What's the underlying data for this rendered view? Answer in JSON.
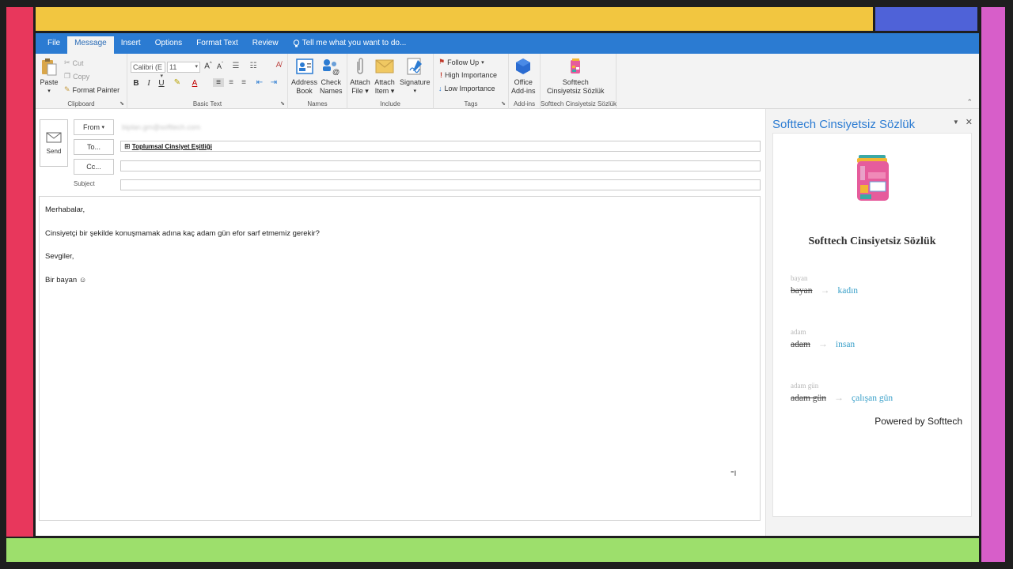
{
  "frame": {
    "left_color": "#e8375c",
    "top_color": "#f2c640",
    "top_right_color": "#4f62d8",
    "right_color": "#d75ec9",
    "bottom_color": "#9ddf6c",
    "accent": "#2b7bd2"
  },
  "menubar": {
    "tabs": [
      "File",
      "Message",
      "Insert",
      "Options",
      "Format Text",
      "Review"
    ],
    "active": "Message",
    "tell_me": "Tell me what you want to do..."
  },
  "ribbon": {
    "clipboard": {
      "paste": "Paste",
      "cut": "Cut",
      "copy": "Copy",
      "format_painter": "Format Painter",
      "label": "Clipboard"
    },
    "basic_text": {
      "font": "Calibri (E",
      "size": "11",
      "label": "Basic Text"
    },
    "names": {
      "address_book_1": "Address",
      "address_book_2": "Book",
      "check_names_1": "Check",
      "check_names_2": "Names",
      "label": "Names"
    },
    "include": {
      "attach_file_1": "Attach",
      "attach_file_2": "File",
      "attach_item_1": "Attach",
      "attach_item_2": "Item",
      "signature": "Signature",
      "label": "Include"
    },
    "tags": {
      "follow_up": "Follow Up",
      "high_importance": "High Importance",
      "low_importance": "Low Importance",
      "label": "Tags"
    },
    "addins": {
      "office_1": "Office",
      "office_2": "Add-ins",
      "label": "Add-ins"
    },
    "softtech": {
      "line1": "Softtech",
      "line2": "Cinsiyetsiz Sözlük",
      "label": "Softtech Cinsiyetsiz Sözlük"
    }
  },
  "compose": {
    "send": "Send",
    "from_label": "From",
    "from_value": "biplan.gm@softtech.com",
    "to_label": "To...",
    "to_value": "Toplumsal Cinsiyet Eşitliği",
    "cc_label": "Cc...",
    "subject_label": "Subject",
    "body": [
      "Merhabalar,",
      "Cinsiyetçi bir şekilde konuşmamak adına kaç adam gün efor sarf etmemiz gerekir?",
      "Sevgiler,",
      "Bir bayan ☺"
    ]
  },
  "pane": {
    "title": "Softtech Cinsiyetsiz Sözlük",
    "card_title": "Softtech Cinsiyetsiz Sözlük",
    "entries": [
      {
        "key": "bayan",
        "old": "bayan",
        "new": "kadın"
      },
      {
        "key": "adam",
        "old": "adam",
        "new": "insan"
      },
      {
        "key": "adam gün",
        "old": "adam gün",
        "new": "çalışan gün"
      }
    ],
    "powered_by": "Powered by Softtech"
  }
}
